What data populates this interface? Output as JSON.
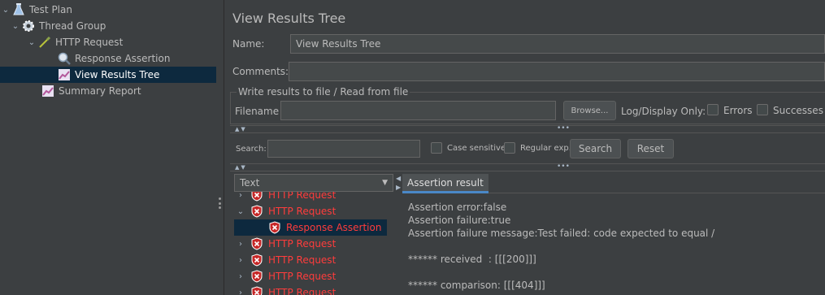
{
  "tree": {
    "items": [
      {
        "label": "Test Plan",
        "icon": "flask-icon",
        "chevron": "⌄"
      },
      {
        "label": "Thread Group",
        "icon": "gear-icon",
        "chevron": "⌄"
      },
      {
        "label": "HTTP Request",
        "icon": "pipette-icon",
        "chevron": "⌄"
      },
      {
        "label": "Response Assertion",
        "icon": "magnifier-icon",
        "chevron": ""
      },
      {
        "label": "View Results Tree",
        "icon": "graph-icon",
        "chevron": ""
      },
      {
        "label": "Summary Report",
        "icon": "graph-icon",
        "chevron": ""
      }
    ],
    "selected_label": "View Results Tree"
  },
  "panel": {
    "title": "View Results Tree",
    "name_label": "Name:",
    "name_value": "View Results Tree",
    "comments_label": "Comments:",
    "comments_value": "",
    "file_group_title": "Write results to file / Read from file",
    "filename_label": "Filename",
    "filename_value": "",
    "browse_label": "Browse...",
    "log_display_label": "Log/Display Only:",
    "errors_label": "Errors",
    "successes_label": "Successes",
    "search_label": "Search:",
    "search_value": "",
    "case_sensitive_label": "Case sensitive",
    "regular_exp_label": "Regular exp.",
    "search_button": "Search",
    "reset_button": "Reset",
    "renderer_value": "Text"
  },
  "results": {
    "items": [
      {
        "label": "HTTP Request",
        "chevron": "›"
      },
      {
        "label": "HTTP Request",
        "chevron": "⌄"
      },
      {
        "label": "Response Assertion",
        "chevron": ""
      },
      {
        "label": "HTTP Request",
        "chevron": "›"
      },
      {
        "label": "HTTP Request",
        "chevron": "›"
      },
      {
        "label": "HTTP Request",
        "chevron": "›"
      },
      {
        "label": "HTTP Request",
        "chevron": "›"
      }
    ],
    "selected_label": "Response Assertion"
  },
  "assertion": {
    "tab_label": "Assertion result",
    "lines": [
      "Assertion error:false",
      "Assertion failure:true",
      "Assertion failure message:Test failed: code expected to equal /",
      "",
      "****** received  : [[[200]]]",
      "",
      "****** comparison: [[[404]]]"
    ]
  },
  "colors": {
    "background": "#3c3f41",
    "selection": "#0d293e",
    "error_text": "#ff3c3c",
    "tab_accent": "#4a88c7"
  }
}
